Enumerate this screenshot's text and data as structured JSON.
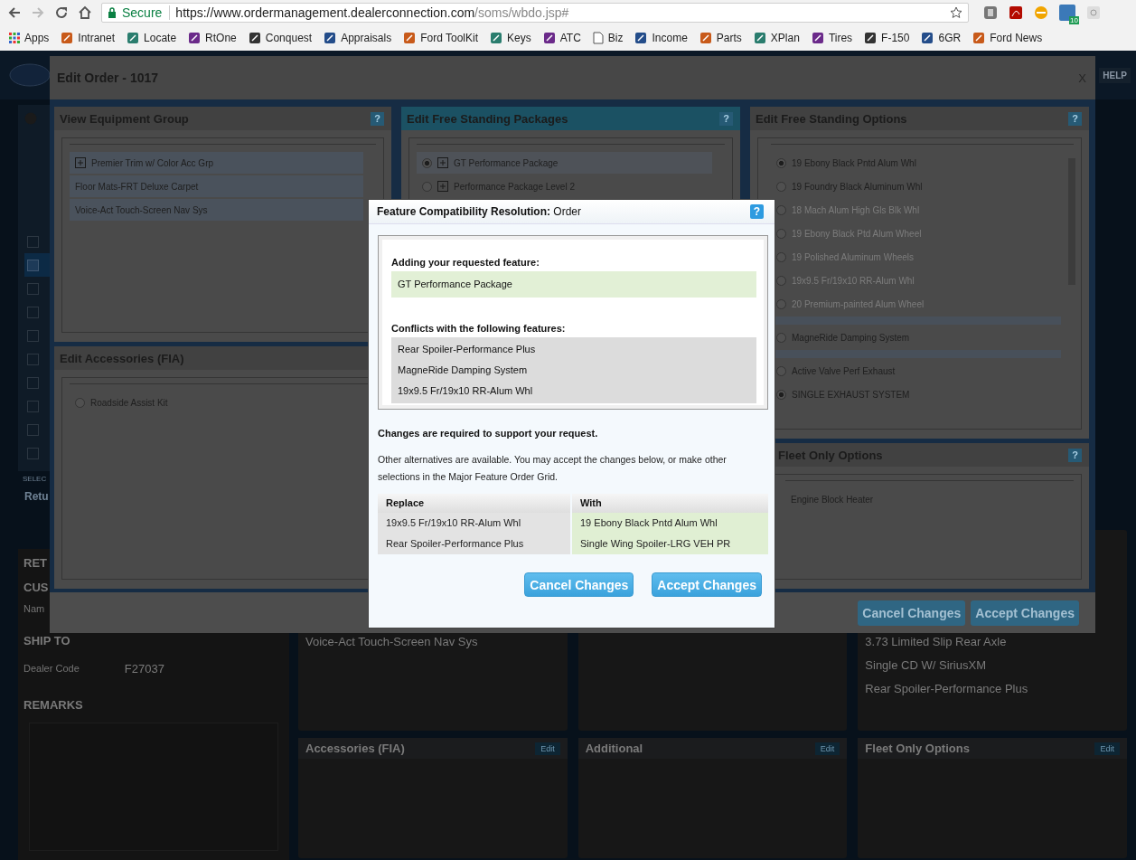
{
  "browser": {
    "secure_label": "Secure",
    "url_host": "https://www.ordermanagement.dealerconnection.com",
    "url_path": "/soms/wbdo.jsp#",
    "extension_badge": "10",
    "bookmarks": [
      {
        "label": "Apps",
        "kind": "apps"
      },
      {
        "label": "Intranet",
        "kind": "site"
      },
      {
        "label": "Locate",
        "kind": "site"
      },
      {
        "label": "RtOne",
        "kind": "site"
      },
      {
        "label": "Conquest",
        "kind": "site"
      },
      {
        "label": "Appraisals",
        "kind": "site"
      },
      {
        "label": "Ford ToolKit",
        "kind": "site"
      },
      {
        "label": "Keys",
        "kind": "site"
      },
      {
        "label": "ATC",
        "kind": "site"
      },
      {
        "label": "Biz",
        "kind": "page"
      },
      {
        "label": "Income",
        "kind": "site"
      },
      {
        "label": "Parts",
        "kind": "site"
      },
      {
        "label": "XPlan",
        "kind": "site"
      },
      {
        "label": "Tires",
        "kind": "site"
      },
      {
        "label": "F-150",
        "kind": "site"
      },
      {
        "label": "6GR",
        "kind": "site"
      },
      {
        "label": "Ford News",
        "kind": "site"
      }
    ]
  },
  "background_page": {
    "help": "HELP",
    "rows": [
      {
        "checked": false
      },
      {
        "checked": true
      },
      {
        "checked": false
      },
      {
        "checked": false
      },
      {
        "checked": false
      },
      {
        "checked": false
      },
      {
        "checked": false
      },
      {
        "checked": false
      },
      {
        "checked": false
      },
      {
        "checked": false
      }
    ],
    "sidebar_texts": [
      "SELEC",
      "Retu"
    ],
    "order_panel": {
      "section_1": "RET",
      "section_2": "CUS",
      "name_label": "Nam",
      "ship_to": "SHIP TO",
      "dealer_code_label": "Dealer Code",
      "dealer_code": "F27037",
      "remarks": "REMARKS"
    },
    "cards_top": [
      {
        "items": [
          "Voice-Act Touch-Screen Nav Sys"
        ]
      },
      {
        "items": [
          "3.73 Limited Slip Rear Axle",
          "Single CD W/ SiriusXM",
          "Rear Spoiler-Performance Plus"
        ]
      }
    ],
    "cards_bottom": [
      {
        "title": "Accessories (FIA)",
        "button": "Edit"
      },
      {
        "title": "Additional",
        "button": "Edit"
      },
      {
        "title": "Fleet Only Options",
        "button": "Edit"
      }
    ]
  },
  "edit_order": {
    "title": "Edit Order - 1017",
    "close": "X",
    "equipment": {
      "title": "View Equipment Group",
      "help": "?",
      "items": [
        {
          "label": "Premier Trim w/ Color Acc Grp",
          "expandable": true
        },
        {
          "label": "Floor Mats-FRT Deluxe Carpet",
          "expandable": false
        },
        {
          "label": "Voice-Act Touch-Screen Nav Sys",
          "expandable": false
        }
      ]
    },
    "accessories": {
      "title": "Edit Accessories (FIA)",
      "items": [
        {
          "label": "Roadside Assist Kit",
          "selected": false
        }
      ]
    },
    "packages": {
      "title": "Edit Free Standing Packages",
      "help": "?",
      "active": true,
      "items": [
        {
          "label": "GT Performance Package",
          "selected": true
        },
        {
          "label": "Performance Package Level 2",
          "selected": false
        }
      ]
    },
    "options": {
      "title": "Edit Free Standing Options",
      "help": "?",
      "items": [
        {
          "kind": "option",
          "label": "19 Ebony Black Pntd Alum Whl",
          "selected": true,
          "disabled": false
        },
        {
          "kind": "option",
          "label": "19 Foundry Black Aluminum Whl",
          "selected": false,
          "disabled": false
        },
        {
          "kind": "option",
          "label": "18 Mach Alum High Gls Blk Whl",
          "selected": false,
          "disabled": true
        },
        {
          "kind": "option",
          "label": "19 Ebony Black Ptd Alum Wheel",
          "selected": false,
          "disabled": true
        },
        {
          "kind": "option",
          "label": "19 Polished Aluminum Wheels",
          "selected": false,
          "disabled": true
        },
        {
          "kind": "option",
          "label": "19x9.5 Fr/19x10 RR-Alum Whl",
          "selected": false,
          "disabled": true
        },
        {
          "kind": "option",
          "label": "20 Premium-painted Alum Wheel",
          "selected": false,
          "disabled": true
        },
        {
          "kind": "separator"
        },
        {
          "kind": "option",
          "label": "MagneRide Damping System",
          "selected": false,
          "disabled": false
        },
        {
          "kind": "separator"
        },
        {
          "kind": "option",
          "label": "Active Valve Perf Exhaust",
          "selected": false,
          "disabled": false
        },
        {
          "kind": "option",
          "label": "SINGLE EXHAUST SYSTEM",
          "selected": true,
          "disabled": false
        }
      ]
    },
    "fleet": {
      "title": "Fleet Only Options",
      "help": "?",
      "items": [
        "Engine Block Heater"
      ]
    },
    "buttons": [
      "Cancel Changes",
      "Accept Changes"
    ]
  },
  "dialog": {
    "title": "**Feature Compatibility Resolution:** Order",
    "help": "?",
    "adding_label": "Adding your requested feature:",
    "requested": [
      "GT Performance Package"
    ],
    "conflicts_label": "Conflicts with the following features:",
    "conflicts": [
      "Rear Spoiler-Performance Plus",
      "MagneRide Damping System",
      "19x9.5 Fr/19x10 RR-Alum Whl"
    ],
    "notice": "Changes are required to support your request.",
    "info": "Other alternatives are available. You may accept the changes below, or make other selections in the Major Feature Order Grid.",
    "table": {
      "columns": [
        "Replace",
        "With"
      ],
      "rows": [
        [
          "19x9.5 Fr/19x10 RR-Alum Whl",
          "19 Ebony Black Pntd Alum Whl"
        ],
        [
          "Rear Spoiler-Performance Plus",
          "Single Wing Spoiler-LRG VEH PR"
        ]
      ]
    },
    "buttons": [
      "Cancel Changes",
      "Accept Changes"
    ]
  }
}
